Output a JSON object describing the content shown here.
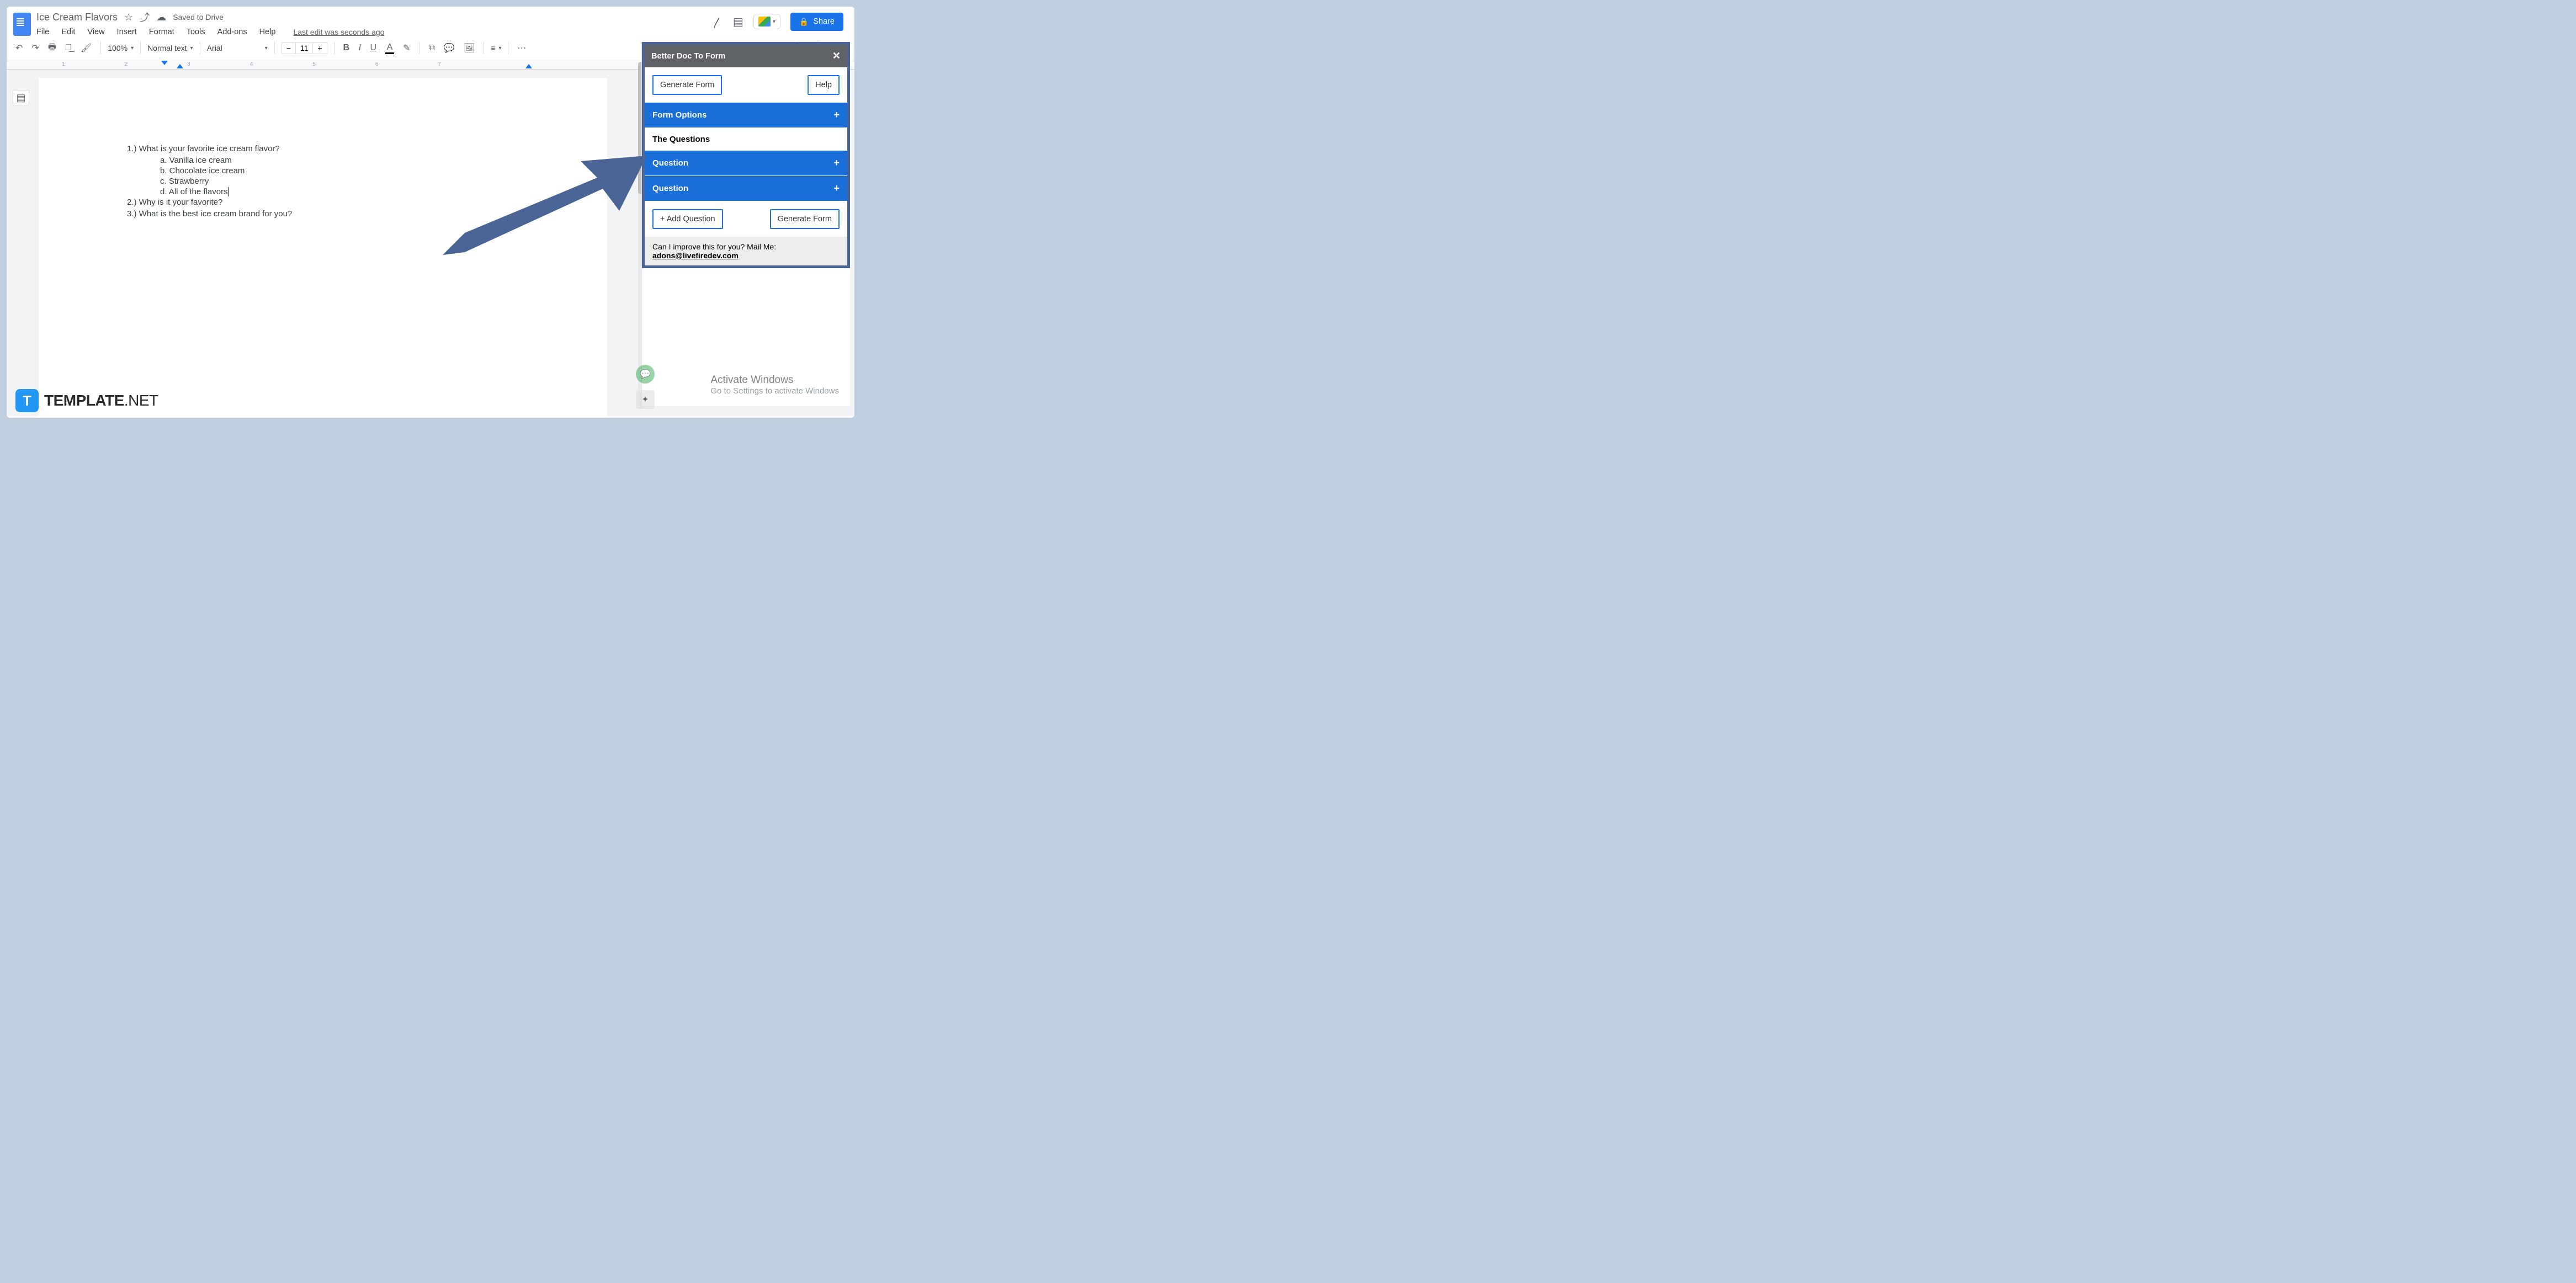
{
  "doc": {
    "title": "Ice Cream Flavors",
    "saved": "Saved to Drive",
    "last_edit": "Last edit was seconds ago"
  },
  "menu": {
    "file": "File",
    "edit": "Edit",
    "view": "View",
    "insert": "Insert",
    "format": "Format",
    "tools": "Tools",
    "addons": "Add-ons",
    "help": "Help"
  },
  "toolbar": {
    "zoom": "100%",
    "style": "Normal text",
    "font": "Arial",
    "size": "11"
  },
  "share": {
    "label": "Share"
  },
  "content": {
    "q1": "1.)  What is your favorite ice cream flavor?",
    "q1a": "a.   Vanilla ice cream",
    "q1b": "b.   Chocolate ice cream",
    "q1c": "c.   Strawberry",
    "q1d": "d.   All of the flavors",
    "q2": "2.)  Why is it your favorite?",
    "q3": "3.)  What is the best ice cream brand for you?"
  },
  "addon": {
    "title": "Better Doc To Form",
    "generate": "Generate Form",
    "help": "Help",
    "form_options": "Form Options",
    "the_questions": "The Questions",
    "question": "Question",
    "add_question": "+ Add Question",
    "generate2": "Generate Form",
    "footer_text": "Can I improve this for you? Mail Me:",
    "footer_email": "adons@livefiredev.com"
  },
  "watermark": {
    "h": "Activate Windows",
    "s": "Go to Settings to activate Windows"
  },
  "brand": {
    "logo_letter": "T",
    "name1": "TEMPLATE",
    "name2": ".NET"
  },
  "ruler": {
    "n1": "1",
    "n2": "2",
    "n3": "3",
    "n4": "4",
    "n5": "5",
    "n6": "6",
    "n7": "7"
  }
}
